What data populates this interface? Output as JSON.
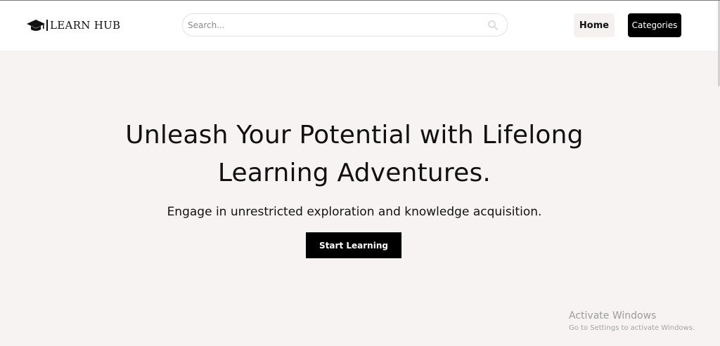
{
  "brand": {
    "name": "LEARN HUB",
    "icon": "graduation-cap-icon"
  },
  "search": {
    "placeholder": "Search...",
    "value": "",
    "icon": "search-icon"
  },
  "nav": {
    "home_label": "Home",
    "categories_label": "Categories"
  },
  "hero": {
    "title_line1": "Unleash Your Potential with Lifelong",
    "title_line2": "Learning Adventures.",
    "subtitle": "Engage in unrestricted exploration and knowledge acquisition.",
    "cta_label": "Start Learning"
  },
  "watermark": {
    "title": "Activate Windows",
    "subtitle": "Go to Settings to activate Windows."
  },
  "colors": {
    "page_background": "#f7f3f3",
    "navbar_background": "#ffffff",
    "primary_button": "#000000",
    "home_button_background": "#f6f1f1"
  }
}
